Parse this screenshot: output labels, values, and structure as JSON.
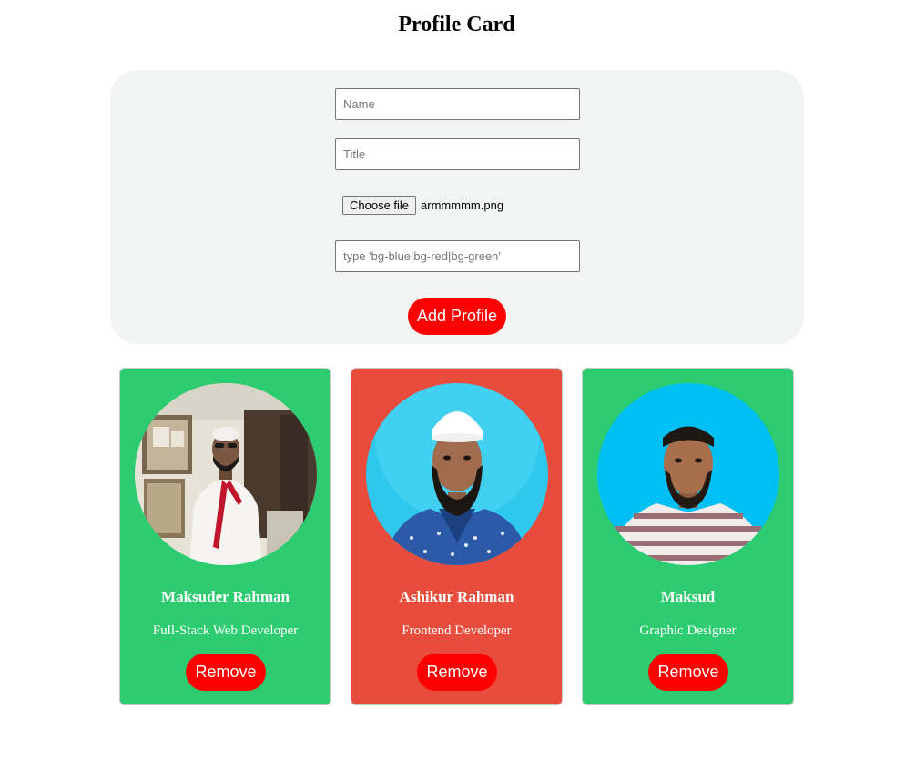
{
  "page": {
    "title": "Profile Card"
  },
  "form": {
    "name_placeholder": "Name",
    "title_placeholder": "Title",
    "file_button_label": "Choose file",
    "file_name": "armmmmm.png",
    "color_placeholder": "type 'bg-blue|bg-red|bg-green'",
    "add_label": "Add Profile"
  },
  "colors": {
    "green": "#2ecc71",
    "red": "#e74c3c",
    "button_red": "#ff0000",
    "panel": "#f1f4f3"
  },
  "cards": [
    {
      "name": "Maksuder Rahman",
      "title": "Full-Stack Web Developer",
      "bg": "bg-green",
      "remove_label": "Remove"
    },
    {
      "name": "Ashikur Rahman",
      "title": "Frontend Developer",
      "bg": "bg-red",
      "remove_label": "Remove"
    },
    {
      "name": "Maksud",
      "title": "Graphic Designer",
      "bg": "bg-green",
      "remove_label": "Remove"
    }
  ]
}
